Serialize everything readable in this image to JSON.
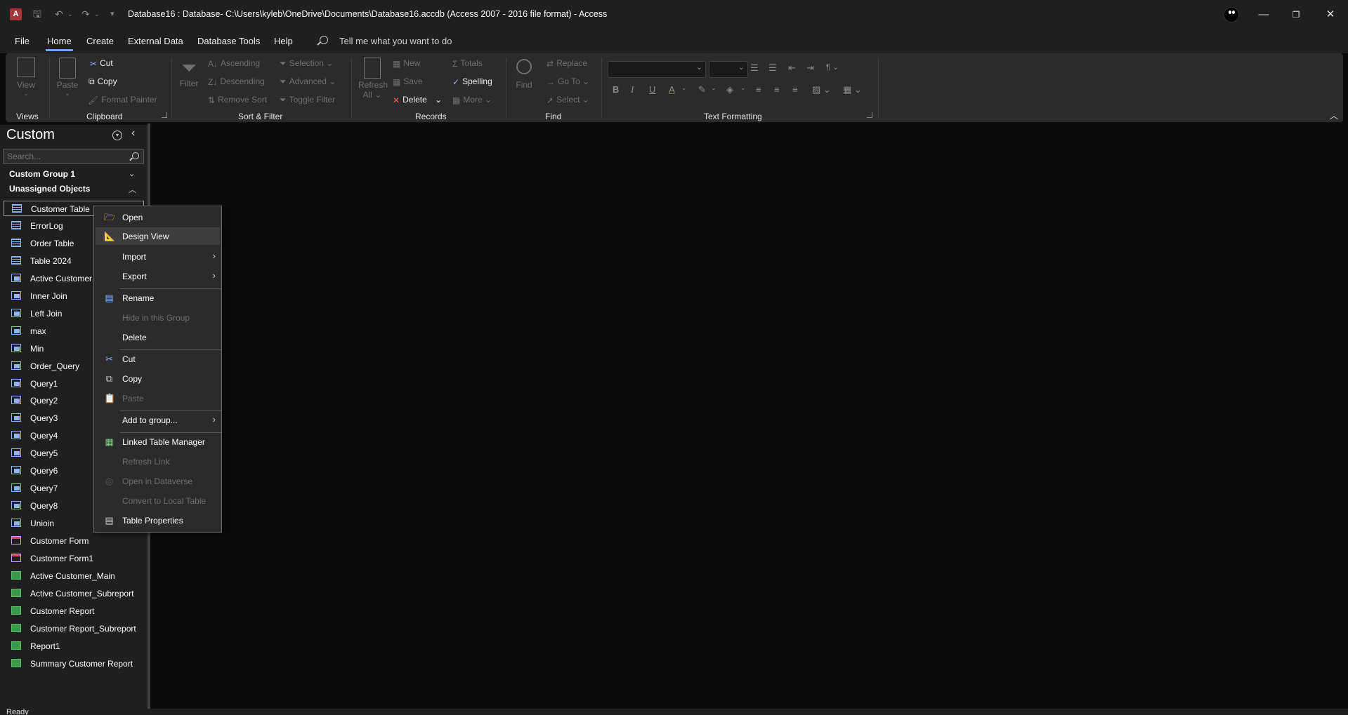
{
  "window": {
    "title": "Database16 : Database- C:\\Users\\kyleb\\OneDrive\\Documents\\Database16.accdb (Access 2007 - 2016 file format)  -  Access",
    "app_icon_letter": "A"
  },
  "menu_tabs": [
    "File",
    "Home",
    "Create",
    "External Data",
    "Database Tools",
    "Help"
  ],
  "active_tab": "Home",
  "tell_me": "Tell me what you want to do",
  "ribbon": {
    "views": {
      "view": "View",
      "group": "Views"
    },
    "clipboard": {
      "paste": "Paste",
      "cut": "Cut",
      "copy": "Copy",
      "format_painter": "Format Painter",
      "group": "Clipboard"
    },
    "sort_filter": {
      "filter": "Filter",
      "ascending": "Ascending",
      "descending": "Descending",
      "remove_sort": "Remove Sort",
      "selection": "Selection",
      "advanced": "Advanced",
      "toggle_filter": "Toggle Filter",
      "group": "Sort & Filter"
    },
    "records": {
      "refresh_all": "Refresh",
      "refresh_all_2": "All",
      "new": "New",
      "save": "Save",
      "delete": "Delete",
      "totals": "Totals",
      "spelling": "Spelling",
      "more": "More",
      "group": "Records"
    },
    "find": {
      "find": "Find",
      "replace": "Replace",
      "go_to": "Go To",
      "select": "Select",
      "group": "Find"
    },
    "text_formatting": {
      "bold": "B",
      "italic": "I",
      "underline": "U",
      "font_color": "A",
      "group": "Text Formatting"
    }
  },
  "nav_pane": {
    "title": "Custom",
    "search_placeholder": "Search...",
    "groups": [
      "Custom Group 1",
      "Unassigned Objects"
    ],
    "items": [
      {
        "label": "Customer Table",
        "type": "table"
      },
      {
        "label": "ErrorLog",
        "type": "table"
      },
      {
        "label": "Order Table",
        "type": "table"
      },
      {
        "label": "Table 2024",
        "type": "table"
      },
      {
        "label": "Active Customer",
        "type": "query"
      },
      {
        "label": "Inner Join",
        "type": "query"
      },
      {
        "label": "Left Join",
        "type": "query"
      },
      {
        "label": "max",
        "type": "query"
      },
      {
        "label": "Min",
        "type": "query"
      },
      {
        "label": "Order_Query",
        "type": "query"
      },
      {
        "label": "Query1",
        "type": "query"
      },
      {
        "label": "Query2",
        "type": "query"
      },
      {
        "label": "Query3",
        "type": "query"
      },
      {
        "label": "Query4",
        "type": "query"
      },
      {
        "label": "Query5",
        "type": "query"
      },
      {
        "label": "Query6",
        "type": "query"
      },
      {
        "label": "Query7",
        "type": "query"
      },
      {
        "label": "Query8",
        "type": "query"
      },
      {
        "label": "Unioin",
        "type": "query"
      },
      {
        "label": "Customer Form",
        "type": "form"
      },
      {
        "label": "Customer Form1",
        "type": "form"
      },
      {
        "label": "Active Customer_Main",
        "type": "report"
      },
      {
        "label": "Active Customer_Subreport",
        "type": "report"
      },
      {
        "label": "Customer Report",
        "type": "report"
      },
      {
        "label": "Customer Report_Subreport",
        "type": "report"
      },
      {
        "label": "Report1",
        "type": "report"
      },
      {
        "label": "Summary Customer Report",
        "type": "report"
      }
    ]
  },
  "context_menu": {
    "items": [
      {
        "label": "Open",
        "enabled": true
      },
      {
        "label": "Design View",
        "enabled": true
      },
      {
        "label": "Import",
        "enabled": true
      },
      {
        "label": "Export",
        "enabled": true
      },
      {
        "label": "Rename",
        "enabled": true
      },
      {
        "label": "Hide in this Group",
        "enabled": false
      },
      {
        "label": "Delete",
        "enabled": true
      },
      {
        "label": "Cut",
        "enabled": true
      },
      {
        "label": "Copy",
        "enabled": true
      },
      {
        "label": "Paste",
        "enabled": false
      },
      {
        "label": "Add to group...",
        "enabled": true
      },
      {
        "label": "Linked Table Manager",
        "enabled": true
      },
      {
        "label": "Refresh Link",
        "enabled": false
      },
      {
        "label": "Open in Dataverse",
        "enabled": false
      },
      {
        "label": "Convert to Local Table",
        "enabled": false
      },
      {
        "label": "Table Properties",
        "enabled": true
      }
    ]
  },
  "status_bar": "Ready",
  "colors": {
    "accent": "#6fa8ff",
    "background": "#0b0b0b",
    "chrome": "#1f1f1f",
    "ribbon": "#2b2b2b"
  }
}
